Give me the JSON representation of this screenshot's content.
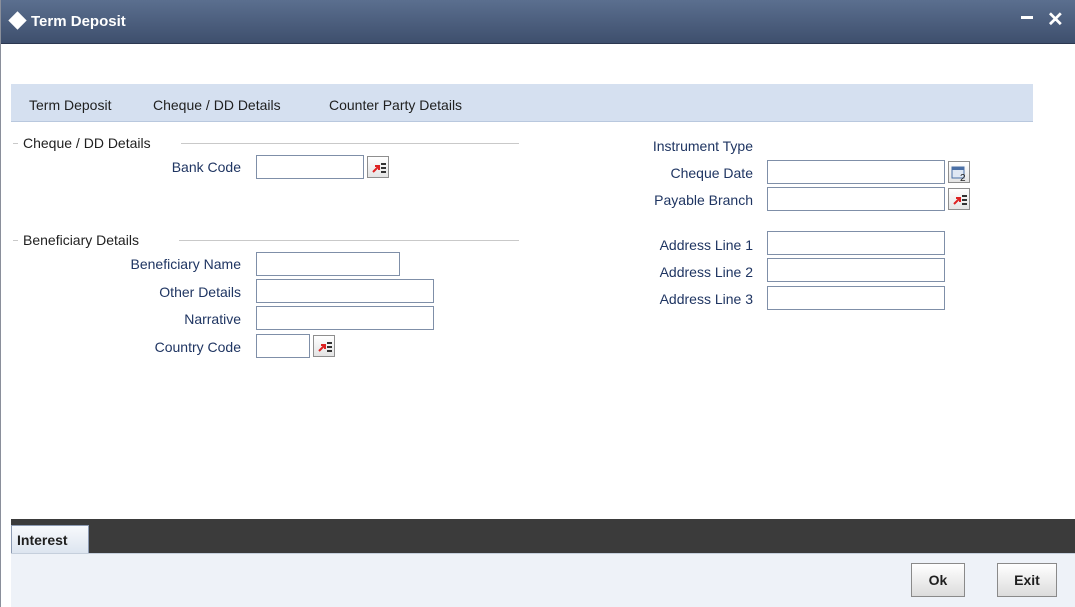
{
  "window": {
    "title": "Term Deposit"
  },
  "tabs": [
    {
      "label": "Term Deposit"
    },
    {
      "label": "Cheque / DD Details"
    },
    {
      "label": "Counter Party Details"
    }
  ],
  "cheque_section": {
    "title": "Cheque / DD Details",
    "bank_code": {
      "label": "Bank Code",
      "value": ""
    }
  },
  "beneficiary_section": {
    "title": "Beneficiary Details",
    "beneficiary_name": {
      "label": "Beneficiary Name",
      "value": ""
    },
    "other_details": {
      "label": "Other Details",
      "value": ""
    },
    "narrative": {
      "label": "Narrative",
      "value": ""
    },
    "country_code": {
      "label": "Country Code",
      "value": ""
    }
  },
  "right_fields": {
    "instrument_type": {
      "label": "Instrument Type"
    },
    "cheque_date": {
      "label": "Cheque Date",
      "value": ""
    },
    "payable_branch": {
      "label": "Payable Branch",
      "value": ""
    },
    "address_line_1": {
      "label": "Address Line 1",
      "value": ""
    },
    "address_line_2": {
      "label": "Address Line 2",
      "value": ""
    },
    "address_line_3": {
      "label": "Address Line 3",
      "value": ""
    }
  },
  "subtabs": [
    {
      "label": "Interest"
    }
  ],
  "buttons": {
    "ok": "Ok",
    "exit": "Exit"
  },
  "icons": {
    "title": "diamond-icon",
    "minimize": "minimize-icon",
    "close": "close-icon",
    "lov": "list-of-values-icon",
    "calendar": "calendar-icon"
  },
  "colors": {
    "titlebar": "#4a5b7b",
    "tabbar": "#d5e0f0",
    "label_text": "#1f3562",
    "bottom_bar": "#3b3b3b"
  }
}
